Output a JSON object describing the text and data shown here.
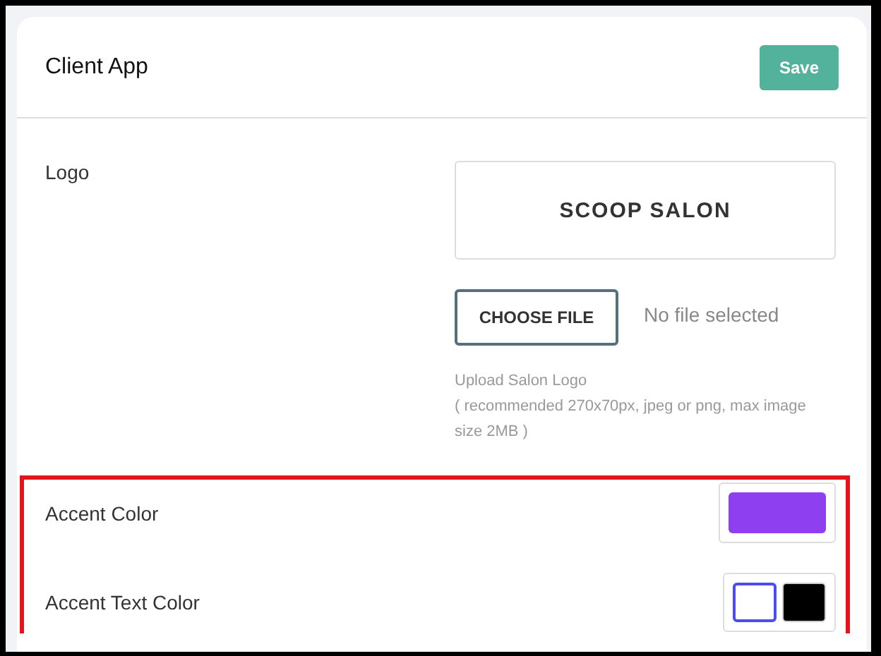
{
  "header": {
    "title": "Client App",
    "save_button": "Save"
  },
  "logo_section": {
    "label": "Logo",
    "logo_text": "SC**OO**P SALON",
    "choose_button": "CHOOSE FILE",
    "file_status": "No file selected",
    "hint_lines": [
      "Upload Salon Logo",
      "( recommended 270x70px, jpeg or png, max image size 2MB )"
    ]
  },
  "color_settings": [
    {
      "label": "Accent Color",
      "kind": "single",
      "swatches": [
        {
          "color": "#8e3ff0",
          "selected": false
        }
      ]
    },
    {
      "label": "Accent Text Color",
      "kind": "choice",
      "swatches": [
        {
          "color": "#ffffff",
          "selected": true
        },
        {
          "color": "#000000",
          "selected": false
        }
      ]
    }
  ]
}
